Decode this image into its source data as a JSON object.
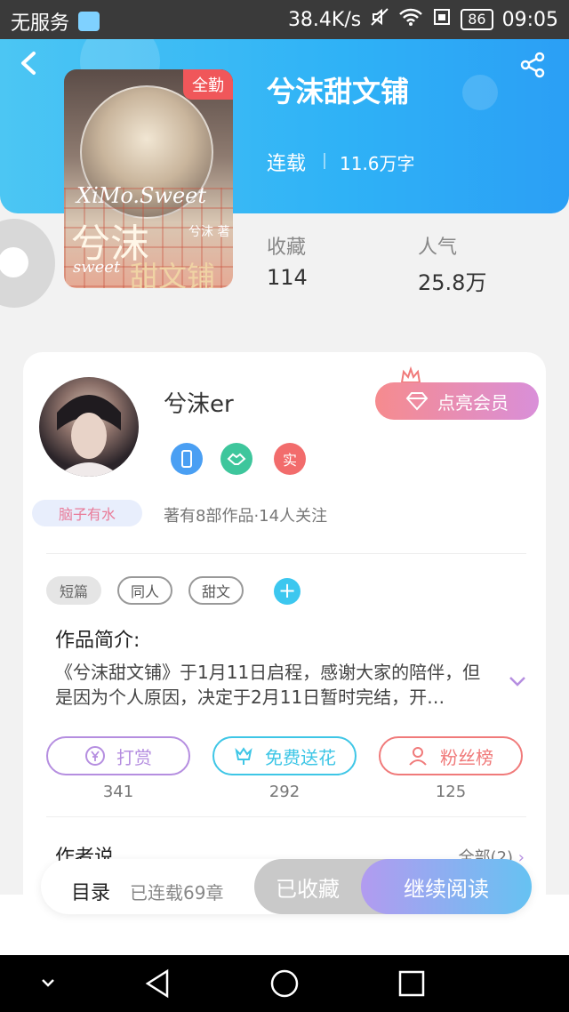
{
  "status_bar": {
    "carrier": "无服务",
    "net_speed": "38.4K/s",
    "battery": "86",
    "time": "09:05"
  },
  "header": {
    "badge": "全勤",
    "book_title": "兮沫甜文铺",
    "status": "连载",
    "word_count": "11.6万字",
    "cover": {
      "script_text": "XiMo.Sweet",
      "title_line1": "兮沫",
      "title_line2": "甜文铺",
      "subtitle": "兮沫 著",
      "small": "sweet"
    }
  },
  "stats": {
    "favorites_label": "收藏",
    "favorites_value": "114",
    "popularity_label": "人气",
    "popularity_value": "25.8万"
  },
  "author": {
    "name": "兮沫er",
    "vip_button": "点亮会员",
    "badge_real": "实",
    "tagline": "脑子有水",
    "meta": "著有8部作品·14人关注"
  },
  "tags": [
    "短篇",
    "同人",
    "甜文"
  ],
  "intro": {
    "heading": "作品简介:",
    "text": "《兮沫甜文铺》于1月11日启程，感谢大家的陪伴，但是因为个人原因，决定于2月11日暂时完结，开…"
  },
  "actions": [
    {
      "label": "打赏",
      "count": "341",
      "color": "#b58ee0"
    },
    {
      "label": "免费送花",
      "count": "292",
      "color": "#3ec6e6"
    },
    {
      "label": "粉丝榜",
      "count": "125",
      "color": "#f07a7a"
    }
  ],
  "author_says": {
    "heading": "作者说",
    "more": "全部(2)"
  },
  "bottom_bar": {
    "toc": "目录",
    "toc_sub": "已连载69章",
    "collected": "已收藏",
    "continue": "继续阅读"
  },
  "colors": {
    "header_start": "#4cc6f3",
    "header_end": "#2b9ff5",
    "vip_gradient_start": "#f68b8e",
    "vip_gradient_end": "#d98fd9",
    "read_gradient_start": "#b29bf0",
    "read_gradient_end": "#66c2f2"
  }
}
